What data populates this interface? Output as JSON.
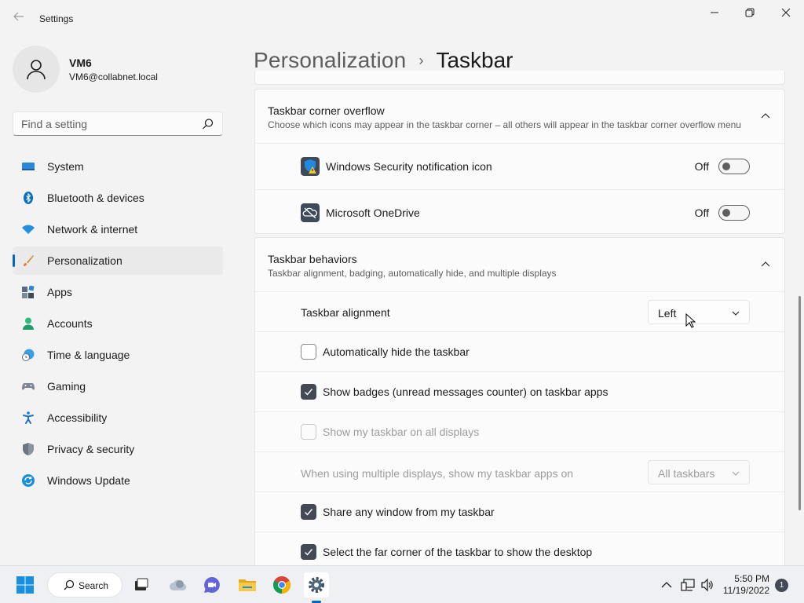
{
  "window": {
    "back_icon": "back-arrow-icon",
    "title": "Settings"
  },
  "profile": {
    "name": "VM6",
    "email": "VM6@collabnet.local"
  },
  "search": {
    "placeholder": "Find a setting"
  },
  "sidebar": {
    "items": [
      {
        "label": "System",
        "icon": "system-icon"
      },
      {
        "label": "Bluetooth & devices",
        "icon": "bluetooth-icon"
      },
      {
        "label": "Network & internet",
        "icon": "wifi-icon"
      },
      {
        "label": "Personalization",
        "icon": "brush-icon",
        "active": true
      },
      {
        "label": "Apps",
        "icon": "apps-icon"
      },
      {
        "label": "Accounts",
        "icon": "accounts-icon"
      },
      {
        "label": "Time & language",
        "icon": "clock-globe-icon"
      },
      {
        "label": "Gaming",
        "icon": "gamepad-icon"
      },
      {
        "label": "Accessibility",
        "icon": "accessibility-icon"
      },
      {
        "label": "Privacy & security",
        "icon": "shield-icon"
      },
      {
        "label": "Windows Update",
        "icon": "update-icon"
      }
    ]
  },
  "breadcrumb": {
    "parent": "Personalization",
    "separator": "›",
    "current": "Taskbar"
  },
  "overflow_section": {
    "title": "Taskbar corner overflow",
    "subtitle": "Choose which icons may appear in the taskbar corner – all others will appear in the taskbar corner overflow menu",
    "items": [
      {
        "label": "Windows Security notification icon",
        "state": "Off",
        "icon": "windows-security-icon"
      },
      {
        "label": "Microsoft OneDrive",
        "state": "Off",
        "icon": "onedrive-icon"
      }
    ]
  },
  "behaviors_section": {
    "title": "Taskbar behaviors",
    "subtitle": "Taskbar alignment, badging, automatically hide, and multiple displays",
    "alignment_label": "Taskbar alignment",
    "alignment_value": "Left",
    "auto_hide_label": "Automatically hide the taskbar",
    "auto_hide_checked": false,
    "badges_label": "Show badges (unread messages counter) on taskbar apps",
    "badges_checked": true,
    "all_displays_label": "Show my taskbar on all displays",
    "all_displays_checked": false,
    "multi_display_label": "When using multiple displays, show my taskbar apps on",
    "multi_display_value": "All taskbars",
    "share_window_label": "Share any window from my taskbar",
    "share_window_checked": true,
    "far_corner_label": "Select the far corner of the taskbar to show the desktop",
    "far_corner_checked": true
  },
  "taskbar": {
    "search_label": "Search",
    "time": "5:50 PM",
    "date": "11/19/2022",
    "notification_count": "1",
    "accent": "#0067c0"
  }
}
